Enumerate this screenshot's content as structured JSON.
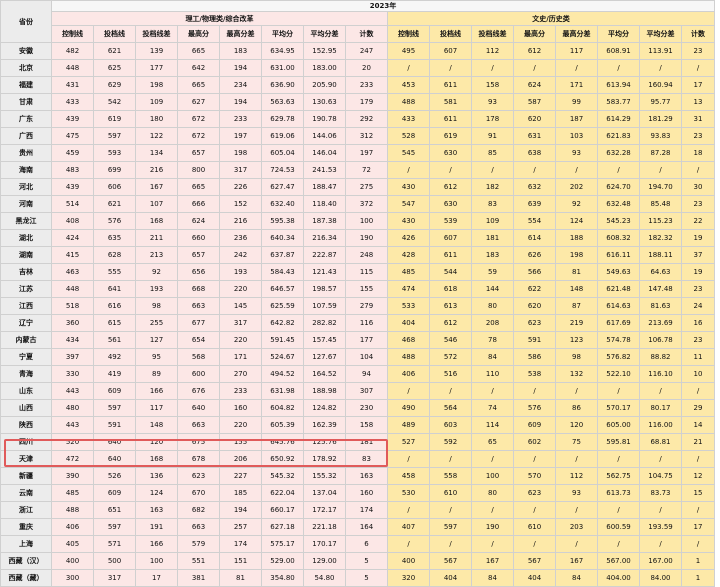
{
  "header": {
    "province_label": "省份",
    "year": "2023年",
    "group_science": "理工/物理类/综合改革",
    "group_arts": "文史/历史类",
    "science_cols": [
      "控制线",
      "投档线",
      "投档线差",
      "最高分",
      "最高分差",
      "平均分",
      "平均分差",
      "计数"
    ],
    "arts_cols": [
      "控制线",
      "投档线",
      "投档线差",
      "最高分",
      "最高分差",
      "平均分",
      "平均分差",
      "计数"
    ]
  },
  "rows": [
    {
      "province": "安徽",
      "sci": [
        "482",
        "621",
        "139",
        "665",
        "183",
        "634.95",
        "152.95",
        "247"
      ],
      "art": [
        "495",
        "607",
        "112",
        "612",
        "117",
        "608.91",
        "113.91",
        "23"
      ]
    },
    {
      "province": "北京",
      "sci": [
        "448",
        "625",
        "177",
        "642",
        "194",
        "631.00",
        "183.00",
        "20"
      ],
      "art": [
        "/",
        "/",
        "/",
        "/",
        "/",
        "/",
        "/",
        "/"
      ]
    },
    {
      "province": "福建",
      "sci": [
        "431",
        "629",
        "198",
        "665",
        "234",
        "636.90",
        "205.90",
        "233"
      ],
      "art": [
        "453",
        "611",
        "158",
        "624",
        "171",
        "613.94",
        "160.94",
        "17"
      ]
    },
    {
      "province": "甘肃",
      "sci": [
        "433",
        "542",
        "109",
        "627",
        "194",
        "563.63",
        "130.63",
        "179"
      ],
      "art": [
        "488",
        "581",
        "93",
        "587",
        "99",
        "583.77",
        "95.77",
        "13"
      ]
    },
    {
      "province": "广东",
      "sci": [
        "439",
        "619",
        "180",
        "672",
        "233",
        "629.78",
        "190.78",
        "292"
      ],
      "art": [
        "433",
        "611",
        "178",
        "620",
        "187",
        "614.29",
        "181.29",
        "31"
      ]
    },
    {
      "province": "广西",
      "sci": [
        "475",
        "597",
        "122",
        "672",
        "197",
        "619.06",
        "144.06",
        "312"
      ],
      "art": [
        "528",
        "619",
        "91",
        "631",
        "103",
        "621.83",
        "93.83",
        "23"
      ]
    },
    {
      "province": "贵州",
      "sci": [
        "459",
        "593",
        "134",
        "657",
        "198",
        "605.04",
        "146.04",
        "197"
      ],
      "art": [
        "545",
        "630",
        "85",
        "638",
        "93",
        "632.28",
        "87.28",
        "18"
      ]
    },
    {
      "province": "海南",
      "sci": [
        "483",
        "699",
        "216",
        "800",
        "317",
        "724.53",
        "241.53",
        "72"
      ],
      "art": [
        "/",
        "/",
        "/",
        "/",
        "/",
        "/",
        "/",
        "/"
      ]
    },
    {
      "province": "河北",
      "sci": [
        "439",
        "606",
        "167",
        "665",
        "226",
        "627.47",
        "188.47",
        "275"
      ],
      "art": [
        "430",
        "612",
        "182",
        "632",
        "202",
        "624.70",
        "194.70",
        "30"
      ]
    },
    {
      "province": "河南",
      "sci": [
        "514",
        "621",
        "107",
        "666",
        "152",
        "632.40",
        "118.40",
        "372"
      ],
      "art": [
        "547",
        "630",
        "83",
        "639",
        "92",
        "632.48",
        "85.48",
        "23"
      ]
    },
    {
      "province": "黑龙江",
      "sci": [
        "408",
        "576",
        "168",
        "624",
        "216",
        "595.38",
        "187.38",
        "100"
      ],
      "art": [
        "430",
        "539",
        "109",
        "554",
        "124",
        "545.23",
        "115.23",
        "22"
      ]
    },
    {
      "province": "湖北",
      "sci": [
        "424",
        "635",
        "211",
        "660",
        "236",
        "640.34",
        "216.34",
        "190"
      ],
      "art": [
        "426",
        "607",
        "181",
        "614",
        "188",
        "608.32",
        "182.32",
        "19"
      ]
    },
    {
      "province": "湖南",
      "sci": [
        "415",
        "628",
        "213",
        "657",
        "242",
        "637.87",
        "222.87",
        "248"
      ],
      "art": [
        "428",
        "611",
        "183",
        "626",
        "198",
        "616.11",
        "188.11",
        "37"
      ]
    },
    {
      "province": "吉林",
      "sci": [
        "463",
        "555",
        "92",
        "656",
        "193",
        "584.43",
        "121.43",
        "115"
      ],
      "art": [
        "485",
        "544",
        "59",
        "566",
        "81",
        "549.63",
        "64.63",
        "19"
      ]
    },
    {
      "province": "江苏",
      "sci": [
        "448",
        "641",
        "193",
        "668",
        "220",
        "646.57",
        "198.57",
        "155"
      ],
      "art": [
        "474",
        "618",
        "144",
        "622",
        "148",
        "621.48",
        "147.48",
        "23"
      ]
    },
    {
      "province": "江西",
      "sci": [
        "518",
        "616",
        "98",
        "663",
        "145",
        "625.59",
        "107.59",
        "279"
      ],
      "art": [
        "533",
        "613",
        "80",
        "620",
        "87",
        "614.63",
        "81.63",
        "24"
      ]
    },
    {
      "province": "辽宁",
      "sci": [
        "360",
        "615",
        "255",
        "677",
        "317",
        "642.82",
        "282.82",
        "116"
      ],
      "art": [
        "404",
        "612",
        "208",
        "623",
        "219",
        "617.69",
        "213.69",
        "16"
      ]
    },
    {
      "province": "内蒙古",
      "sci": [
        "434",
        "561",
        "127",
        "654",
        "220",
        "591.45",
        "157.45",
        "177"
      ],
      "art": [
        "468",
        "546",
        "78",
        "591",
        "123",
        "574.78",
        "106.78",
        "23"
      ]
    },
    {
      "province": "宁夏",
      "sci": [
        "397",
        "492",
        "95",
        "568",
        "171",
        "524.67",
        "127.67",
        "104"
      ],
      "art": [
        "488",
        "572",
        "84",
        "586",
        "98",
        "576.82",
        "88.82",
        "11"
      ]
    },
    {
      "province": "青海",
      "sci": [
        "330",
        "419",
        "89",
        "600",
        "270",
        "494.52",
        "164.52",
        "94"
      ],
      "art": [
        "406",
        "516",
        "110",
        "538",
        "132",
        "522.10",
        "116.10",
        "10"
      ]
    },
    {
      "province": "山东",
      "sci": [
        "443",
        "609",
        "166",
        "676",
        "233",
        "631.98",
        "188.98",
        "307"
      ],
      "art": [
        "/",
        "/",
        "/",
        "/",
        "/",
        "/",
        "/",
        "/"
      ]
    },
    {
      "province": "山西",
      "sci": [
        "480",
        "597",
        "117",
        "640",
        "160",
        "604.82",
        "124.82",
        "230"
      ],
      "art": [
        "490",
        "564",
        "74",
        "576",
        "86",
        "570.17",
        "80.17",
        "29"
      ]
    },
    {
      "province": "陕西",
      "sci": [
        "443",
        "591",
        "148",
        "663",
        "220",
        "605.39",
        "162.39",
        "158"
      ],
      "art": [
        "489",
        "603",
        "114",
        "609",
        "120",
        "605.00",
        "116.00",
        "14"
      ]
    },
    {
      "province": "四川",
      "sci": [
        "520",
        "640",
        "120",
        "675",
        "155",
        "645.76",
        "125.76",
        "181"
      ],
      "art": [
        "527",
        "592",
        "65",
        "602",
        "75",
        "595.81",
        "68.81",
        "21"
      ]
    },
    {
      "province": "天津",
      "sci": [
        "472",
        "640",
        "168",
        "678",
        "206",
        "650.92",
        "178.92",
        "83"
      ],
      "art": [
        "/",
        "/",
        "/",
        "/",
        "/",
        "/",
        "/",
        "/"
      ]
    },
    {
      "province": "新疆",
      "sci": [
        "390",
        "526",
        "136",
        "623",
        "227",
        "545.32",
        "155.32",
        "163"
      ],
      "art": [
        "458",
        "558",
        "100",
        "570",
        "112",
        "562.75",
        "104.75",
        "12"
      ]
    },
    {
      "province": "云南",
      "sci": [
        "485",
        "609",
        "124",
        "670",
        "185",
        "622.04",
        "137.04",
        "160"
      ],
      "art": [
        "530",
        "610",
        "80",
        "623",
        "93",
        "613.73",
        "83.73",
        "15"
      ]
    },
    {
      "province": "浙江",
      "sci": [
        "488",
        "651",
        "163",
        "682",
        "194",
        "660.17",
        "172.17",
        "174"
      ],
      "art": [
        "/",
        "/",
        "/",
        "/",
        "/",
        "/",
        "/",
        "/"
      ]
    },
    {
      "province": "重庆",
      "sci": [
        "406",
        "597",
        "191",
        "663",
        "257",
        "627.18",
        "221.18",
        "164"
      ],
      "art": [
        "407",
        "597",
        "190",
        "610",
        "203",
        "600.59",
        "193.59",
        "17"
      ]
    },
    {
      "province": "上海",
      "sci": [
        "405",
        "571",
        "166",
        "579",
        "174",
        "575.17",
        "170.17",
        "6"
      ],
      "art": [
        "/",
        "/",
        "/",
        "/",
        "/",
        "/",
        "/",
        "/"
      ]
    },
    {
      "province": "西藏（汉）",
      "sci": [
        "400",
        "500",
        "100",
        "551",
        "151",
        "529.00",
        "129.00",
        "5"
      ],
      "art": [
        "400",
        "567",
        "167",
        "567",
        "167",
        "567.00",
        "167.00",
        "1"
      ]
    },
    {
      "province": "西藏（藏）",
      "sci": [
        "300",
        "317",
        "17",
        "381",
        "81",
        "354.80",
        "54.80",
        "5"
      ],
      "art": [
        "320",
        "404",
        "84",
        "404",
        "84",
        "404.00",
        "84.00",
        "1"
      ]
    }
  ]
}
